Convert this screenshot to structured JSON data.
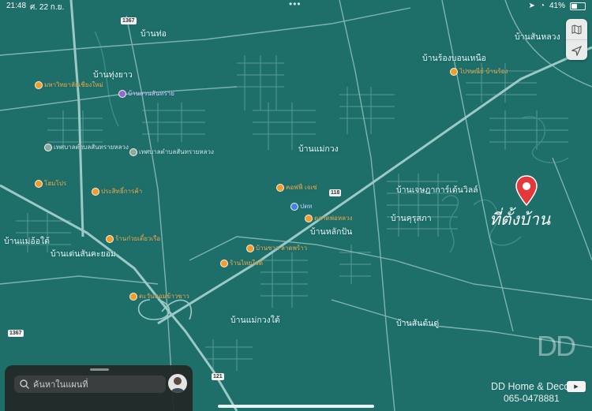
{
  "status_bar": {
    "time": "21:48",
    "date": "ศ. 22 ก.ย.",
    "battery": "41%",
    "battery_level": 0.41
  },
  "places": [
    "บ้านท่อ",
    "บ้านทุ่งยาว",
    "บ้านร้องบอนเหนือ",
    "บ้านสันหลวง",
    "บ้านแม่กวง",
    "บ้านเจษฎาการ์เด้นวิลล์",
    "บ้านคุรุสภา",
    "บ้านหลักปัน",
    "บ้านแม่อ้อใต้",
    "บ้านเด่นสันคะยอม",
    "บ้านแม่กวงใต้",
    "บ้านสันต้นดู่"
  ],
  "pois_orange": [
    "มหาวิทยาลัยเชียงใหม่",
    "โฮมโปร",
    "ประสิทธิ์การค้า",
    "ร้านก๋วยเตี๋ยวเรือ",
    "คอฟฟี่ เจเซ่",
    "ตลาดพ่อหลวง",
    "ร้านไทยใจดี",
    "ตะวันหอมข้าวขาว",
    "ไปรษณีย์ บ้านร้อง",
    "บ้านซาว ลาดพร้าว"
  ],
  "pois_purple": [
    "บ้านสวนสันทราย"
  ],
  "pois_blue": [
    "ปตท"
  ],
  "pois_grey": [
    "เทศบาลตำบลสันทรายหลวง",
    "เทศบาลตำบลสันทรายหลวง"
  ],
  "route_shields": [
    "1367",
    "118",
    "1367",
    "121"
  ],
  "annotation": "ที่ตั้งบ้าน",
  "search": {
    "placeholder": "ค้นหาในแผนที่"
  },
  "watermark": "DD",
  "brand": "DD Home & Decor",
  "phone": "065-0478881",
  "colors": {
    "water_land": "#1e6e6a",
    "roads": "#7fb3b0",
    "pin": "#e5383b",
    "poi": "#f39c2b"
  }
}
